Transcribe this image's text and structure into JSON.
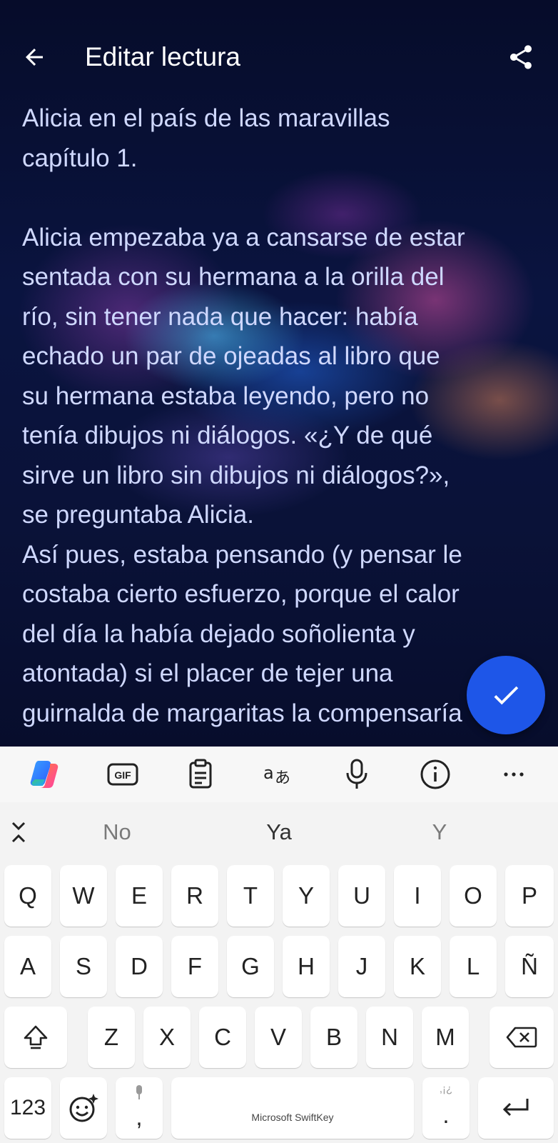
{
  "topbar": {
    "title": "Editar lectura",
    "back_icon": "arrow-left-icon",
    "share_icon": "share-icon"
  },
  "editor": {
    "heading_line1": "Alicia en el país de las maravillas",
    "heading_line2": "capítulo 1.",
    "paragraph1_lines": [
      "Alicia empezaba ya a cansarse de estar",
      "sentada con su hermana a la orilla del",
      "río, sin tener nada que hacer: había",
      "echado un par de ojeadas al libro que",
      "su hermana estaba leyendo, pero no",
      "tenía dibujos ni diálogos. «¿Y de qué",
      "sirve un libro sin dibujos ni diálogos?»,",
      "se preguntaba Alicia."
    ],
    "paragraph2_lines": [
      "Así pues, estaba pensando (y pensar le",
      "costaba cierto esfuerzo, porque el calor",
      "del día la había dejado soñolienta y",
      "atontada) si el placer de tejer una",
      "guirnalda de margaritas la compensaría"
    ],
    "fab_icon": "check-icon",
    "accent_color": "#1e56e8"
  },
  "keyboard": {
    "toolbar_icons": [
      "copilot-icon",
      "gif-icon",
      "clipboard-icon",
      "translate-icon",
      "microphone-icon",
      "info-icon",
      "more-icon"
    ],
    "suggestions": [
      "No",
      "Ya",
      "Y"
    ],
    "row1": [
      "Q",
      "W",
      "E",
      "R",
      "T",
      "Y",
      "U",
      "I",
      "O",
      "P"
    ],
    "row2": [
      "A",
      "S",
      "D",
      "F",
      "G",
      "H",
      "J",
      "K",
      "L",
      "Ñ"
    ],
    "row3": [
      "Z",
      "X",
      "C",
      "V",
      "B",
      "N",
      "M"
    ],
    "numbers_label": "123",
    "comma_label": ",",
    "space_label": "Microsoft SwiftKey",
    "period_label": ".",
    "period_hint": ",¡¿"
  }
}
